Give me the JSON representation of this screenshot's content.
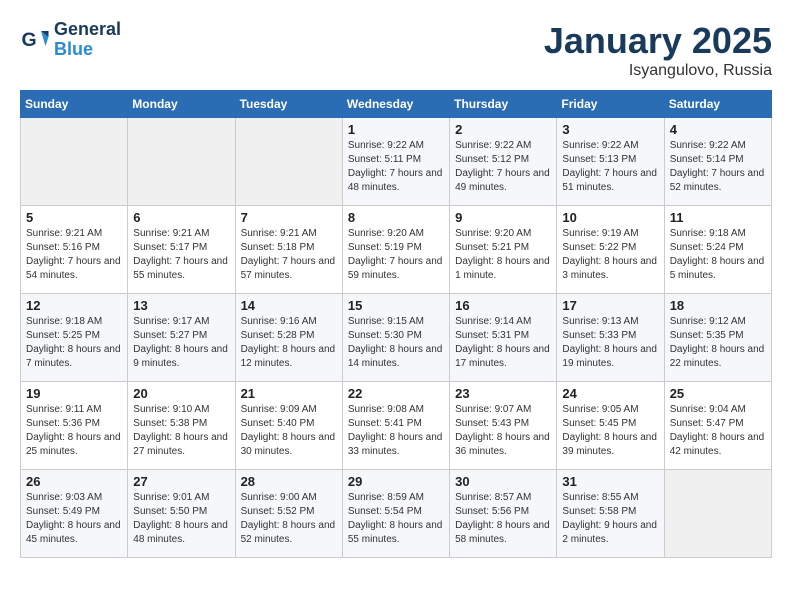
{
  "header": {
    "logo_line1": "General",
    "logo_line2": "Blue",
    "month": "January 2025",
    "location": "Isyangulovo, Russia"
  },
  "weekdays": [
    "Sunday",
    "Monday",
    "Tuesday",
    "Wednesday",
    "Thursday",
    "Friday",
    "Saturday"
  ],
  "weeks": [
    [
      {
        "day": "",
        "sunrise": "",
        "sunset": "",
        "daylight": ""
      },
      {
        "day": "",
        "sunrise": "",
        "sunset": "",
        "daylight": ""
      },
      {
        "day": "",
        "sunrise": "",
        "sunset": "",
        "daylight": ""
      },
      {
        "day": "1",
        "sunrise": "Sunrise: 9:22 AM",
        "sunset": "Sunset: 5:11 PM",
        "daylight": "Daylight: 7 hours and 48 minutes."
      },
      {
        "day": "2",
        "sunrise": "Sunrise: 9:22 AM",
        "sunset": "Sunset: 5:12 PM",
        "daylight": "Daylight: 7 hours and 49 minutes."
      },
      {
        "day": "3",
        "sunrise": "Sunrise: 9:22 AM",
        "sunset": "Sunset: 5:13 PM",
        "daylight": "Daylight: 7 hours and 51 minutes."
      },
      {
        "day": "4",
        "sunrise": "Sunrise: 9:22 AM",
        "sunset": "Sunset: 5:14 PM",
        "daylight": "Daylight: 7 hours and 52 minutes."
      }
    ],
    [
      {
        "day": "5",
        "sunrise": "Sunrise: 9:21 AM",
        "sunset": "Sunset: 5:16 PM",
        "daylight": "Daylight: 7 hours and 54 minutes."
      },
      {
        "day": "6",
        "sunrise": "Sunrise: 9:21 AM",
        "sunset": "Sunset: 5:17 PM",
        "daylight": "Daylight: 7 hours and 55 minutes."
      },
      {
        "day": "7",
        "sunrise": "Sunrise: 9:21 AM",
        "sunset": "Sunset: 5:18 PM",
        "daylight": "Daylight: 7 hours and 57 minutes."
      },
      {
        "day": "8",
        "sunrise": "Sunrise: 9:20 AM",
        "sunset": "Sunset: 5:19 PM",
        "daylight": "Daylight: 7 hours and 59 minutes."
      },
      {
        "day": "9",
        "sunrise": "Sunrise: 9:20 AM",
        "sunset": "Sunset: 5:21 PM",
        "daylight": "Daylight: 8 hours and 1 minute."
      },
      {
        "day": "10",
        "sunrise": "Sunrise: 9:19 AM",
        "sunset": "Sunset: 5:22 PM",
        "daylight": "Daylight: 8 hours and 3 minutes."
      },
      {
        "day": "11",
        "sunrise": "Sunrise: 9:18 AM",
        "sunset": "Sunset: 5:24 PM",
        "daylight": "Daylight: 8 hours and 5 minutes."
      }
    ],
    [
      {
        "day": "12",
        "sunrise": "Sunrise: 9:18 AM",
        "sunset": "Sunset: 5:25 PM",
        "daylight": "Daylight: 8 hours and 7 minutes."
      },
      {
        "day": "13",
        "sunrise": "Sunrise: 9:17 AM",
        "sunset": "Sunset: 5:27 PM",
        "daylight": "Daylight: 8 hours and 9 minutes."
      },
      {
        "day": "14",
        "sunrise": "Sunrise: 9:16 AM",
        "sunset": "Sunset: 5:28 PM",
        "daylight": "Daylight: 8 hours and 12 minutes."
      },
      {
        "day": "15",
        "sunrise": "Sunrise: 9:15 AM",
        "sunset": "Sunset: 5:30 PM",
        "daylight": "Daylight: 8 hours and 14 minutes."
      },
      {
        "day": "16",
        "sunrise": "Sunrise: 9:14 AM",
        "sunset": "Sunset: 5:31 PM",
        "daylight": "Daylight: 8 hours and 17 minutes."
      },
      {
        "day": "17",
        "sunrise": "Sunrise: 9:13 AM",
        "sunset": "Sunset: 5:33 PM",
        "daylight": "Daylight: 8 hours and 19 minutes."
      },
      {
        "day": "18",
        "sunrise": "Sunrise: 9:12 AM",
        "sunset": "Sunset: 5:35 PM",
        "daylight": "Daylight: 8 hours and 22 minutes."
      }
    ],
    [
      {
        "day": "19",
        "sunrise": "Sunrise: 9:11 AM",
        "sunset": "Sunset: 5:36 PM",
        "daylight": "Daylight: 8 hours and 25 minutes."
      },
      {
        "day": "20",
        "sunrise": "Sunrise: 9:10 AM",
        "sunset": "Sunset: 5:38 PM",
        "daylight": "Daylight: 8 hours and 27 minutes."
      },
      {
        "day": "21",
        "sunrise": "Sunrise: 9:09 AM",
        "sunset": "Sunset: 5:40 PM",
        "daylight": "Daylight: 8 hours and 30 minutes."
      },
      {
        "day": "22",
        "sunrise": "Sunrise: 9:08 AM",
        "sunset": "Sunset: 5:41 PM",
        "daylight": "Daylight: 8 hours and 33 minutes."
      },
      {
        "day": "23",
        "sunrise": "Sunrise: 9:07 AM",
        "sunset": "Sunset: 5:43 PM",
        "daylight": "Daylight: 8 hours and 36 minutes."
      },
      {
        "day": "24",
        "sunrise": "Sunrise: 9:05 AM",
        "sunset": "Sunset: 5:45 PM",
        "daylight": "Daylight: 8 hours and 39 minutes."
      },
      {
        "day": "25",
        "sunrise": "Sunrise: 9:04 AM",
        "sunset": "Sunset: 5:47 PM",
        "daylight": "Daylight: 8 hours and 42 minutes."
      }
    ],
    [
      {
        "day": "26",
        "sunrise": "Sunrise: 9:03 AM",
        "sunset": "Sunset: 5:49 PM",
        "daylight": "Daylight: 8 hours and 45 minutes."
      },
      {
        "day": "27",
        "sunrise": "Sunrise: 9:01 AM",
        "sunset": "Sunset: 5:50 PM",
        "daylight": "Daylight: 8 hours and 48 minutes."
      },
      {
        "day": "28",
        "sunrise": "Sunrise: 9:00 AM",
        "sunset": "Sunset: 5:52 PM",
        "daylight": "Daylight: 8 hours and 52 minutes."
      },
      {
        "day": "29",
        "sunrise": "Sunrise: 8:59 AM",
        "sunset": "Sunset: 5:54 PM",
        "daylight": "Daylight: 8 hours and 55 minutes."
      },
      {
        "day": "30",
        "sunrise": "Sunrise: 8:57 AM",
        "sunset": "Sunset: 5:56 PM",
        "daylight": "Daylight: 8 hours and 58 minutes."
      },
      {
        "day": "31",
        "sunrise": "Sunrise: 8:55 AM",
        "sunset": "Sunset: 5:58 PM",
        "daylight": "Daylight: 9 hours and 2 minutes."
      },
      {
        "day": "",
        "sunrise": "",
        "sunset": "",
        "daylight": ""
      }
    ]
  ]
}
